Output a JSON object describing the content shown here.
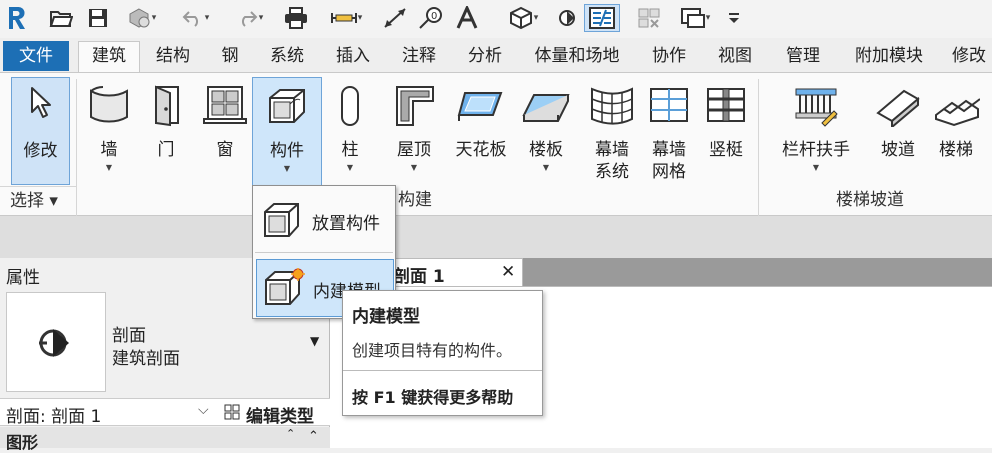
{
  "ribbon_tabs": [
    "文件",
    "建筑",
    "结构",
    "钢",
    "系统",
    "插入",
    "注释",
    "分析",
    "体量和场地",
    "协作",
    "视图",
    "管理",
    "附加模块",
    "修改"
  ],
  "ribbon_buttons": {
    "modify": "修改",
    "wall": "墙",
    "door": "门",
    "window": "窗",
    "component": "构件",
    "column": "柱",
    "roof": "屋顶",
    "ceiling": "天花板",
    "floor": "楼板",
    "curtain_system_1": "幕墙",
    "curtain_system_2": "系统",
    "curtain_grid_1": "幕墙",
    "curtain_grid_2": "网格",
    "mullion": "竖梃",
    "railing": "栏杆扶手",
    "ramp": "坡道",
    "stair": "楼梯"
  },
  "panels": {
    "select": "选择 ▾",
    "build": "构建",
    "circulation": "楼梯坡道"
  },
  "component_menu": {
    "place": "放置构件",
    "inplace": "内建模型"
  },
  "tooltip": {
    "title": "内建模型",
    "desc": "创建项目特有的构件。",
    "help": "按 F1 键获得更多帮助"
  },
  "properties": {
    "title": "属性",
    "type_line1": "剖面",
    "type_line2": "建筑剖面",
    "instance": "剖面: 剖面 1",
    "edit_type": "编辑类型",
    "group": "图形"
  },
  "view_tab": {
    "title": "剖面 1",
    "close": "✕"
  },
  "colors": {
    "file_tab": "#1d6fb5",
    "select_blue": "#cfe3f7",
    "accent_border": "#6ea4d8"
  }
}
